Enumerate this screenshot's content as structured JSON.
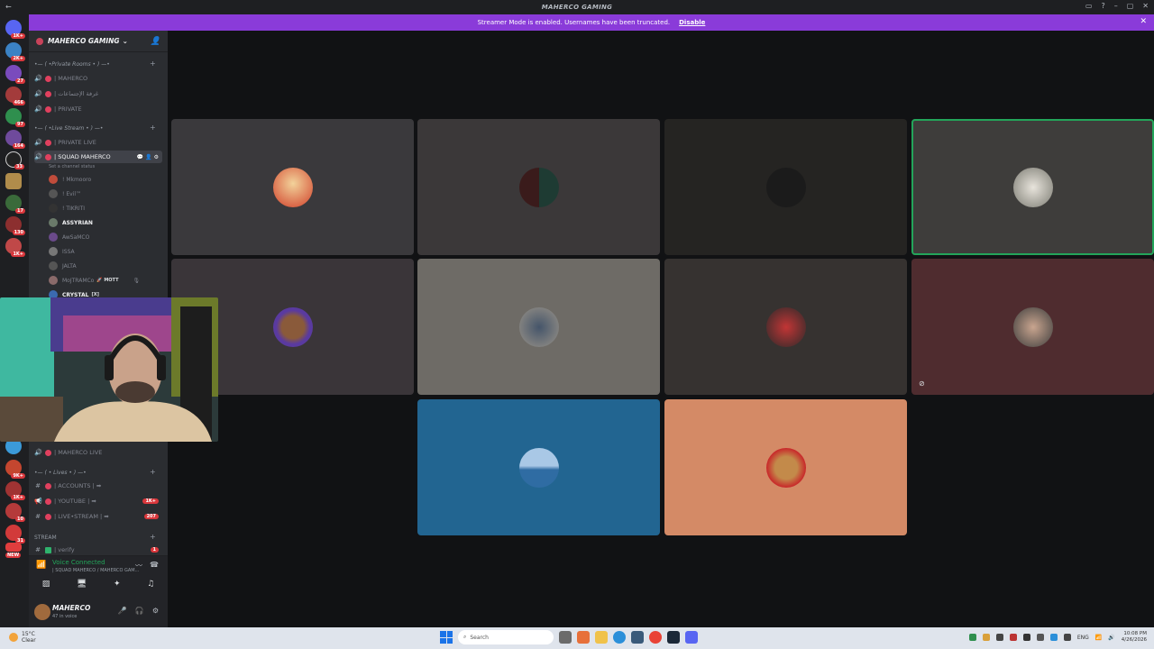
{
  "window": {
    "title": "MAHERCO GAMING"
  },
  "banner": {
    "message": "Streamer Mode is enabled. Usernames have been truncated.",
    "action": "Disable"
  },
  "server_badges": [
    "1K+",
    "2K+",
    "27",
    "466",
    "97",
    "164",
    "33",
    "17",
    "130",
    "1K+",
    "9K+",
    "1K+",
    "10",
    "31",
    "NEW"
  ],
  "guild": {
    "name": "MAHERCO GAMING"
  },
  "categories": {
    "private_rooms": "•— ( •Private Rooms • ) —•",
    "live_stream": "•— ( •Live Stream • ) —•",
    "lives": "•— ( • Lives • ) —•",
    "stream": "STREAM"
  },
  "channels": {
    "maherco": "| MAHERCO",
    "meetings": "| غرفة الإجتماعات",
    "private": "| PRIVATE",
    "private_live": "| PRIVATE LIVE",
    "squad": "| SQUAD MAHERCO",
    "squad_status": "Set a channel status",
    "maherco_live": "| MAHERCO LIVE",
    "accounts": "| ACCOUNTS | ➡",
    "youtube": "| YOUTUBE | ➡",
    "youtube_count": "1K+",
    "live_stream": "| LIVE•STREAM | ➡",
    "live_stream_count": "207",
    "verify": "| verify",
    "verify_count": "1"
  },
  "voice_users": [
    {
      "name": "! Mkmooro",
      "bright": false
    },
    {
      "name": "! Evil™",
      "bright": false
    },
    {
      "name": "! TIKRITI",
      "bright": false
    },
    {
      "name": "ASSYRIAN",
      "bright": true
    },
    {
      "name": "AwSaMCO",
      "bright": false
    },
    {
      "name": "ISSA",
      "bright": false
    },
    {
      "name": "JALTA",
      "bright": false
    },
    {
      "name": "MoJTRAMCo",
      "bright": false,
      "tag": "🚀 MOTT"
    },
    {
      "name": "CRYSTAL",
      "bright": true,
      "tag": "[X]"
    }
  ],
  "voice_connection": {
    "status": "Voice Connected",
    "location": "| SQUAD MAHERCO / MAHERCO GAM..."
  },
  "user": {
    "name": "MAHERCO",
    "status": "47 in voice"
  },
  "taskbar": {
    "temp": "15°C",
    "condition": "Clear",
    "search_placeholder": "Search",
    "language": "ENG",
    "time": "10:08 PM",
    "date": "4/26/2026"
  },
  "colors": {
    "accent": "#8a3bd9",
    "speaking": "#23a55a",
    "channel_dot": "#e0405e"
  }
}
